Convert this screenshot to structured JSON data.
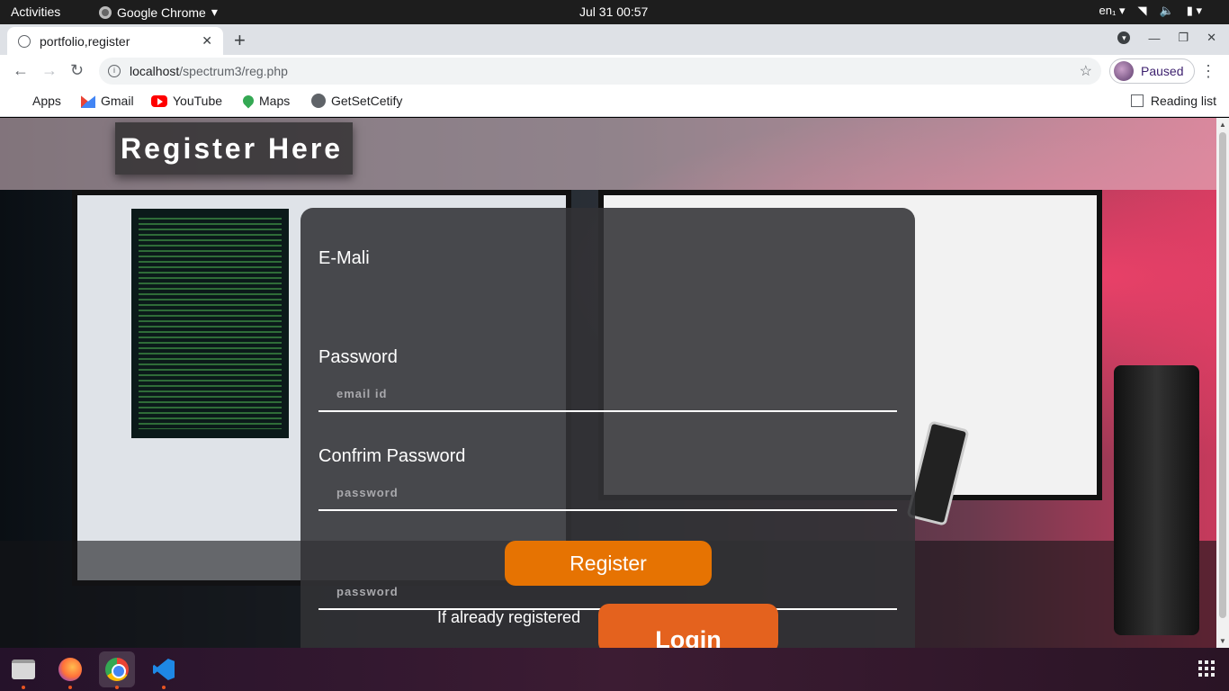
{
  "system": {
    "activities": "Activities",
    "app_name": "Google Chrome",
    "clock": "Jul 31  00:57",
    "lang": "en₁"
  },
  "browser": {
    "tab_title": "portfolio,register",
    "url_host": "localhost",
    "url_path": "/spectrum3/reg.php",
    "profile_label": "Paused",
    "bookmarks": [
      "Apps",
      "Gmail",
      "YouTube",
      "Maps",
      "GetSetCetify"
    ],
    "reading_list": "Reading list"
  },
  "page": {
    "heading": "Register Here",
    "email_label": "E-Mali",
    "email_placeholder": "email id",
    "password_label": "Password",
    "password_placeholder": "password",
    "confirm_label": "Confrim Password",
    "confirm_placeholder": "password",
    "register_button": "Register",
    "already_text": "If already registered",
    "login_button": "Login"
  },
  "dock": {
    "apps": [
      "files-icon",
      "firefox-icon",
      "chrome-icon",
      "vscode-icon"
    ],
    "accent": "#e95420"
  }
}
